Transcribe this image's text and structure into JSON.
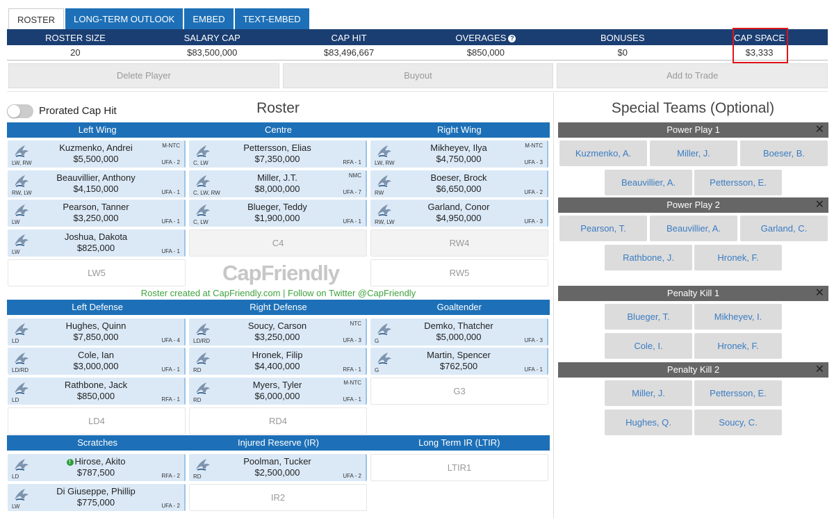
{
  "tabs": [
    "ROSTER",
    "LONG-TERM OUTLOOK",
    "EMBED",
    "TEXT-EMBED"
  ],
  "cap": {
    "headers": [
      "ROSTER SIZE",
      "SALARY CAP",
      "CAP HIT",
      "OVERAGES",
      "BONUSES",
      "CAP SPACE"
    ],
    "values": [
      "20",
      "$83,500,000",
      "$83,496,667",
      "$850,000",
      "$0",
      "$3,333"
    ]
  },
  "actions": [
    "Delete Player",
    "Buyout",
    "Add to Trade"
  ],
  "prorated_label": "Prorated Cap Hit",
  "roster_title": "Roster",
  "special_title": "Special Teams (Optional)",
  "forward_headers": [
    "Left Wing",
    "Centre",
    "Right Wing"
  ],
  "defense_headers": [
    "Left Defense",
    "Right Defense",
    "Goaltender"
  ],
  "reserve_headers": [
    "Scratches",
    "Injured Reserve (IR)",
    "Long Term IR (LTIR)"
  ],
  "players": [
    {
      "name": "Kuzmenko, Andrei",
      "salary": "$5,500,000",
      "pos": "LW, RW",
      "clause": "M-NTC",
      "status": "UFA - 2"
    },
    {
      "name": "Pettersson, Elias",
      "salary": "$7,350,000",
      "pos": "C, LW",
      "clause": "",
      "status": "RFA - 1"
    },
    {
      "name": "Mikheyev, Ilya",
      "salary": "$4,750,000",
      "pos": "LW, RW",
      "clause": "M-NTC",
      "status": "UFA - 3"
    },
    {
      "name": "Beauvillier, Anthony",
      "salary": "$4,150,000",
      "pos": "RW, LW",
      "clause": "",
      "status": "UFA - 1"
    },
    {
      "name": "Miller, J.T.",
      "salary": "$8,000,000",
      "pos": "C, LW, RW",
      "clause": "NMC",
      "status": "UFA - 7"
    },
    {
      "name": "Boeser, Brock",
      "salary": "$6,650,000",
      "pos": "RW",
      "clause": "",
      "status": "UFA - 2"
    },
    {
      "name": "Pearson, Tanner",
      "salary": "$3,250,000",
      "pos": "LW",
      "clause": "",
      "status": "UFA - 1"
    },
    {
      "name": "Blueger, Teddy",
      "salary": "$1,900,000",
      "pos": "C, LW",
      "clause": "",
      "status": "UFA - 1"
    },
    {
      "name": "Garland, Conor",
      "salary": "$4,950,000",
      "pos": "RW, LW",
      "clause": "",
      "status": "UFA - 3"
    },
    {
      "name": "Joshua, Dakota",
      "salary": "$825,000",
      "pos": "LW",
      "clause": "",
      "status": "UFA - 1"
    },
    {
      "name": "Hughes, Quinn",
      "salary": "$7,850,000",
      "pos": "LD",
      "clause": "",
      "status": "UFA - 4"
    },
    {
      "name": "Soucy, Carson",
      "salary": "$3,250,000",
      "pos": "LD/RD",
      "clause": "NTC",
      "status": "UFA - 3"
    },
    {
      "name": "Demko, Thatcher",
      "salary": "$5,000,000",
      "pos": "G",
      "clause": "",
      "status": "UFA - 3"
    },
    {
      "name": "Cole, Ian",
      "salary": "$3,000,000",
      "pos": "LD/RD",
      "clause": "",
      "status": "UFA - 1"
    },
    {
      "name": "Hronek, Filip",
      "salary": "$4,400,000",
      "pos": "RD",
      "clause": "",
      "status": "RFA - 1"
    },
    {
      "name": "Martin, Spencer",
      "salary": "$762,500",
      "pos": "G",
      "clause": "",
      "status": "UFA - 1"
    },
    {
      "name": "Rathbone, Jack",
      "salary": "$850,000",
      "pos": "LD",
      "clause": "",
      "status": "RFA - 1"
    },
    {
      "name": "Myers, Tyler",
      "salary": "$6,000,000",
      "pos": "RD",
      "clause": "M-NTC",
      "status": "UFA - 1"
    },
    {
      "name": "Hirose, Akito",
      "salary": "$787,500",
      "pos": "LD",
      "clause": "",
      "status": "RFA - 2"
    },
    {
      "name": "Poolman, Tucker",
      "salary": "$2,500,000",
      "pos": "RD",
      "clause": "",
      "status": "UFA - 2"
    },
    {
      "name": "Di Giuseppe, Phillip",
      "salary": "$775,000",
      "pos": "LW",
      "clause": "",
      "status": "UFA - 2"
    }
  ],
  "empty_slots": [
    "C4",
    "RW4",
    "LW5",
    "RW5",
    "G3",
    "LD4",
    "RD4",
    "LTIR1",
    "IR2"
  ],
  "brand": {
    "text": "CapFriendly"
  },
  "credit": "Roster created at CapFriendly.com | Follow on Twitter @CapFriendly",
  "special_teams": [
    {
      "title": "Power Play 1",
      "players": [
        "Kuzmenko, A.",
        "Miller, J.",
        "Boeser, B.",
        "Beauvillier, A.",
        "Pettersson, E."
      ]
    },
    {
      "title": "Power Play 2",
      "players": [
        "Pearson, T.",
        "Beauvillier, A.",
        "Garland, C.",
        "Rathbone, J.",
        "Hronek, F."
      ]
    },
    {
      "title": "Penalty Kill 1",
      "players": [
        "Blueger, T.",
        "Mikheyev, I.",
        "Cole, I.",
        "Hronek, F."
      ]
    },
    {
      "title": "Penalty Kill 2",
      "players": [
        "Miller, J.",
        "Pettersson, E.",
        "Hughes, Q.",
        "Soucy, C."
      ]
    }
  ],
  "close_symbol": "✕",
  "colors": {
    "header_dark": "#1a3e72",
    "header_blue": "#1d70b7",
    "card": "#dbe9f7",
    "highlight": "#e0141a",
    "credit": "#3fa23f"
  }
}
